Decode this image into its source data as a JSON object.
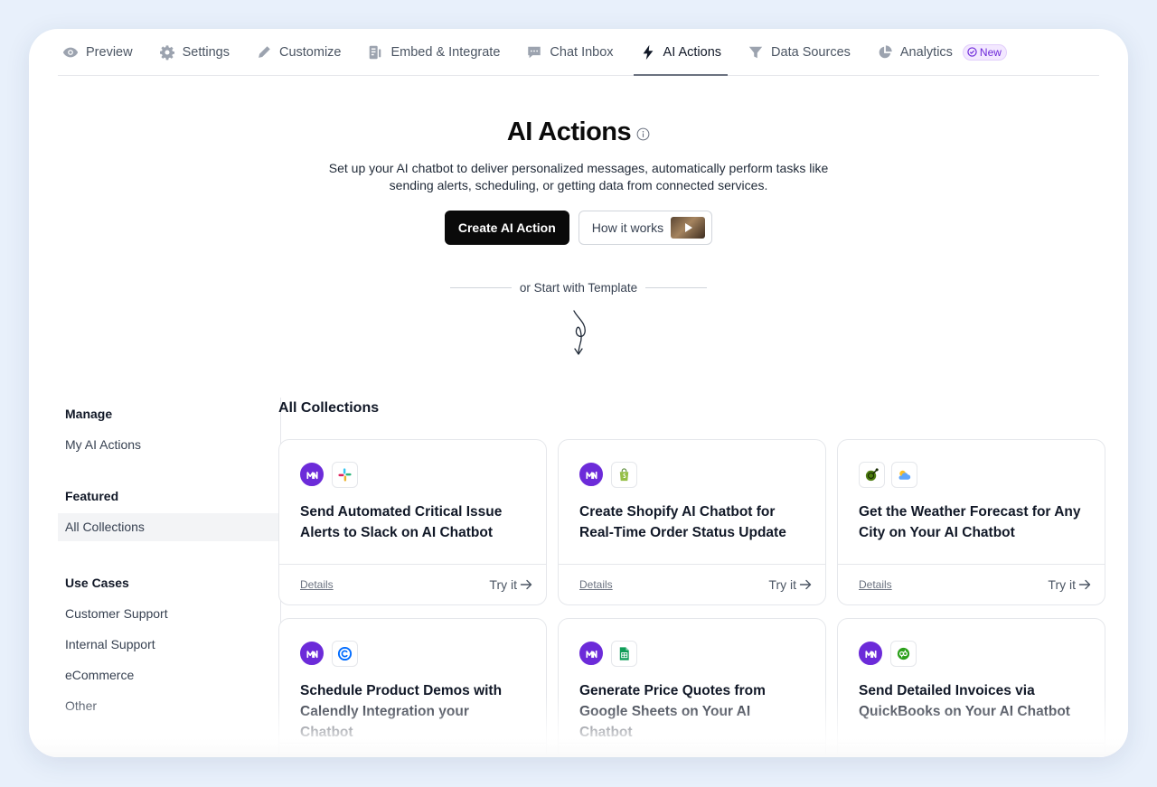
{
  "nav": {
    "tabs": [
      {
        "label": "Preview",
        "icon": "eye-icon"
      },
      {
        "label": "Settings",
        "icon": "gear-icon"
      },
      {
        "label": "Customize",
        "icon": "pencil-icon"
      },
      {
        "label": "Embed & Integrate",
        "icon": "embed-icon"
      },
      {
        "label": "Chat Inbox",
        "icon": "chat-icon"
      },
      {
        "label": "AI Actions",
        "icon": "lightning-icon",
        "active": true
      },
      {
        "label": "Data Sources",
        "icon": "funnel-icon"
      },
      {
        "label": "Analytics",
        "icon": "pie-chart-icon"
      }
    ],
    "new_badge": "New"
  },
  "hero": {
    "title": "AI Actions",
    "description": "Set up your AI chatbot to deliver personalized messages, automatically perform tasks like sending alerts, scheduling, or getting data from connected services.",
    "create_button": "Create AI Action",
    "how_button": "How it works",
    "template_divider": "or Start with Template"
  },
  "sidebar": {
    "manage_heading": "Manage",
    "my_actions": "My AI Actions",
    "featured_heading": "Featured",
    "all_collections": "All Collections",
    "use_cases_heading": "Use Cases",
    "use_cases": [
      "Customer Support",
      "Internal Support",
      "eCommerce",
      "Other"
    ]
  },
  "collections": {
    "title": "All Collections",
    "details_label": "Details",
    "try_label": "Try it",
    "cards": [
      {
        "title": "Send Automated Critical Issue Alerts to Slack on AI Chatbot",
        "app_icon": "slack-icon"
      },
      {
        "title": "Create Shopify AI Chatbot for Real-Time Order Status Update",
        "app_icon": "shopify-icon"
      },
      {
        "title": "Get the Weather Forecast for Any City on Your AI Chatbot",
        "app_icon": "weather-icon"
      },
      {
        "title": "Schedule Product Demos with Calendly Integration your Chatbot",
        "app_icon": "calendly-icon"
      },
      {
        "title": "Generate Price Quotes from Google Sheets on Your AI Chatbot",
        "app_icon": "google-sheets-icon"
      },
      {
        "title": "Send Detailed Invoices via QuickBooks on Your AI Chatbot",
        "app_icon": "quickbooks-icon"
      }
    ]
  },
  "colors": {
    "brand": "#6c2bd9",
    "primary_button": "#0a0a0a",
    "new_badge": "#6d28d9"
  }
}
